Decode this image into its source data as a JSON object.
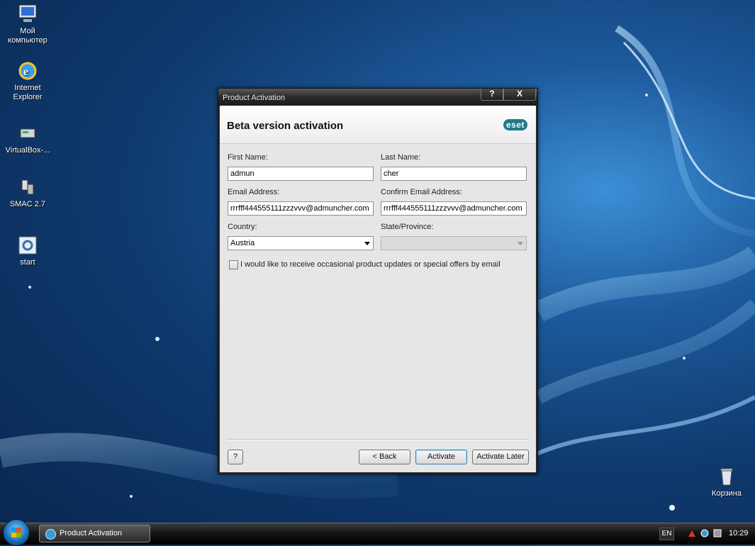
{
  "desktop": {
    "icons": [
      {
        "label": "Мой компьютер"
      },
      {
        "label": "Internet Explorer"
      },
      {
        "label": "VirtualBox-..."
      },
      {
        "label": "SMAC 2.7"
      },
      {
        "label": "start"
      },
      {
        "label": "Корзина"
      }
    ]
  },
  "window": {
    "title": "Product Activation",
    "help_btn": "?",
    "close_btn": "X",
    "header_title": "Beta version activation",
    "logo": "eset",
    "form": {
      "first_name_label": "First Name:",
      "first_name_value": "admun",
      "last_name_label": "Last Name:",
      "last_name_value": "cher",
      "email_label": "Email Address:",
      "email_value": "rrrfff444555111zzzvvv@admuncher.com",
      "confirm_email_label": "Confirm Email Address:",
      "confirm_email_value": "rrrfff444555111zzzvvv@admuncher.com",
      "country_label": "Country:",
      "country_value": "Austria",
      "state_label": "State/Province:",
      "state_value": "",
      "optin_label": "I would like to receive occasional product updates or special offers by email",
      "optin_checked": false
    },
    "footer": {
      "help": "?",
      "back": "< Back",
      "activate": "Activate",
      "activate_later": "Activate Later"
    }
  },
  "taskbar": {
    "task_item": "Product Activation",
    "language": "EN",
    "clock": "10:29"
  }
}
